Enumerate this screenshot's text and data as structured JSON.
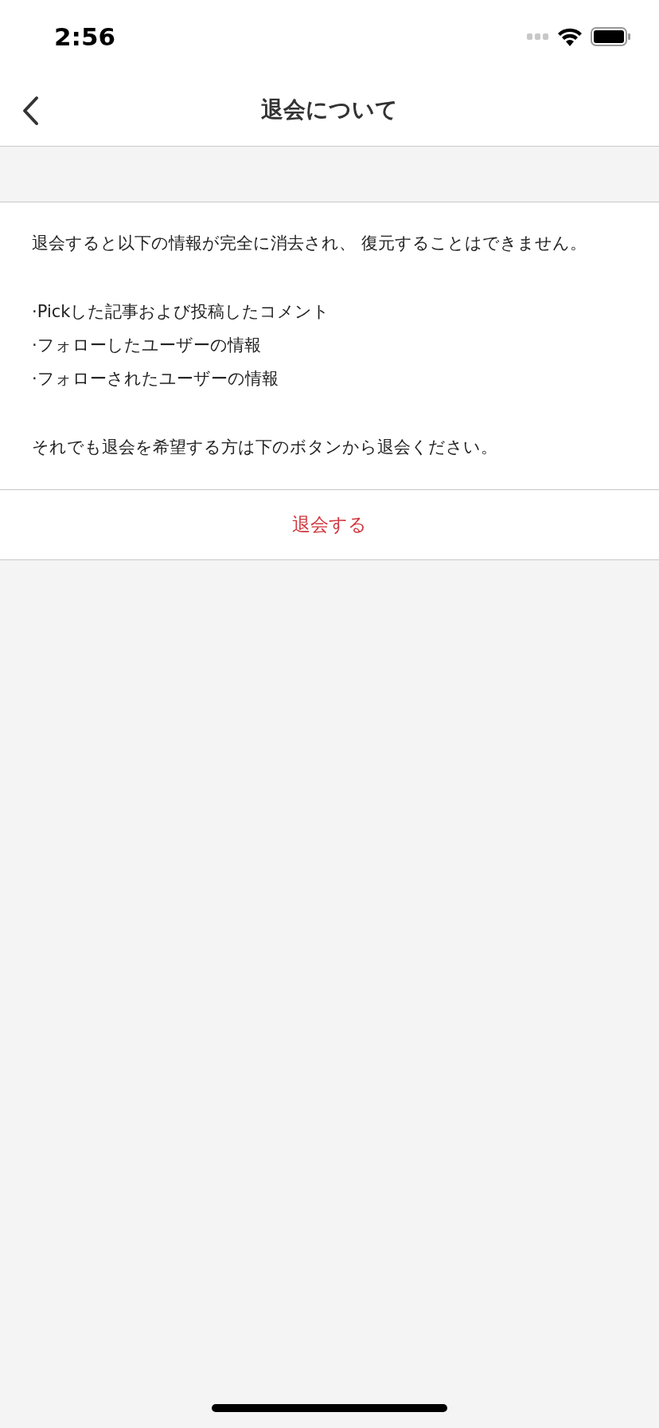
{
  "status_bar": {
    "time": "2:56"
  },
  "nav_bar": {
    "title": "退会について"
  },
  "notice": {
    "intro": "退会すると以下の情報が完全に消去され、 復元することはできません。",
    "items": [
      "·Pickした記事および投稿したコメント",
      "·フォローしたユーザーの情報",
      "·フォローされたユーザーの情報"
    ],
    "outro": "それでも退会を希望する方は下のボタンから退会ください。"
  },
  "action": {
    "label": "退会する"
  }
}
